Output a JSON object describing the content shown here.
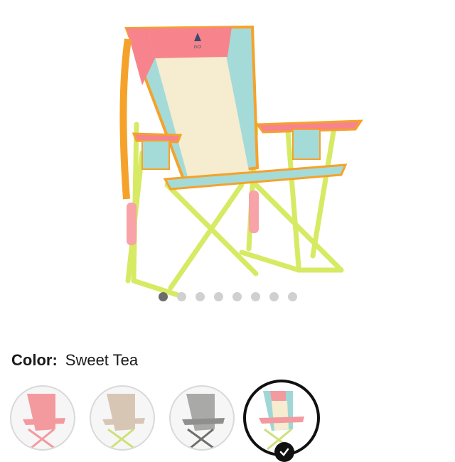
{
  "product": {
    "image_alt": "GCI Outdoor rocker chair",
    "logo_text": "GCI"
  },
  "carousel": {
    "total_images": 8,
    "active_index": 0
  },
  "color_selector": {
    "label": "Color:",
    "selected_value": "Sweet Tea",
    "options": [
      {
        "name": "coral-swatch",
        "color": "#f39a9f"
      },
      {
        "name": "sand-swatch",
        "color": "#d8c6b5"
      },
      {
        "name": "gray-swatch",
        "color": "#a9aaa8"
      },
      {
        "name": "sweet-tea-swatch",
        "color": "#9fd7d6",
        "selected": true
      }
    ]
  },
  "colors": {
    "teal": "#a4dbd9",
    "pink": "#f7848c",
    "cream": "#f6eccf",
    "frame": "#d7ea63",
    "orange": "#f5a22a"
  }
}
